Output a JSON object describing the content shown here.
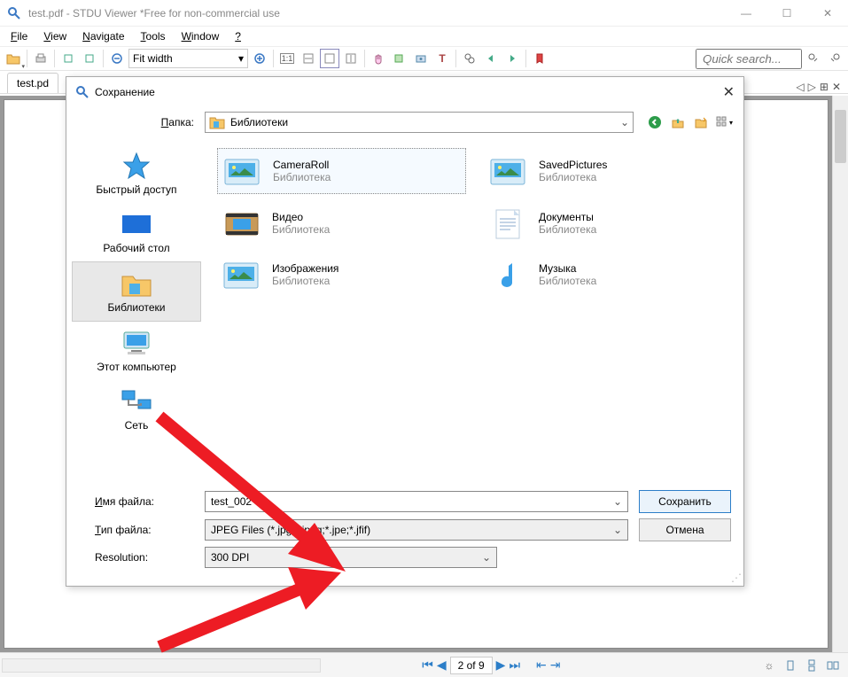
{
  "window": {
    "title": "test.pdf - STDU Viewer *Free for non-commercial use"
  },
  "menu": {
    "file": "File",
    "view": "View",
    "navigate": "Navigate",
    "tools": "Tools",
    "window": "Window",
    "help": "?"
  },
  "toolbar": {
    "zoom_mode": "Fit width",
    "quick_search_placeholder": "Quick search..."
  },
  "tabs": {
    "doc": "test.pd"
  },
  "pagebar": {
    "current": "2 of 9"
  },
  "dialog": {
    "title": "Сохранение",
    "folder_label": "Папка:",
    "folder_value": "Библиотеки",
    "places": {
      "quick": "Быстрый доступ",
      "desktop": "Рабочий стол",
      "libraries": "Библиотеки",
      "thispc": "Этот компьютер",
      "network": "Сеть"
    },
    "libs": {
      "cameraroll": {
        "name": "CameraRoll",
        "sub": "Библиотека"
      },
      "saved": {
        "name": "SavedPictures",
        "sub": "Библиотека"
      },
      "video": {
        "name": "Видео",
        "sub": "Библиотека"
      },
      "docs": {
        "name": "Документы",
        "sub": "Библиотека"
      },
      "images": {
        "name": "Изображения",
        "sub": "Библиотека"
      },
      "music": {
        "name": "Музыка",
        "sub": "Библиотека"
      }
    },
    "filename_label": "Имя файла:",
    "filename_value": "test_002",
    "filetype_label": "Тип файла:",
    "filetype_value": "JPEG Files (*.jpg;*.jpeg;*.jpe;*.jfif)",
    "resolution_label": "Resolution:",
    "resolution_value": "300 DPI",
    "save_btn": "Сохранить",
    "cancel_btn": "Отмена"
  }
}
